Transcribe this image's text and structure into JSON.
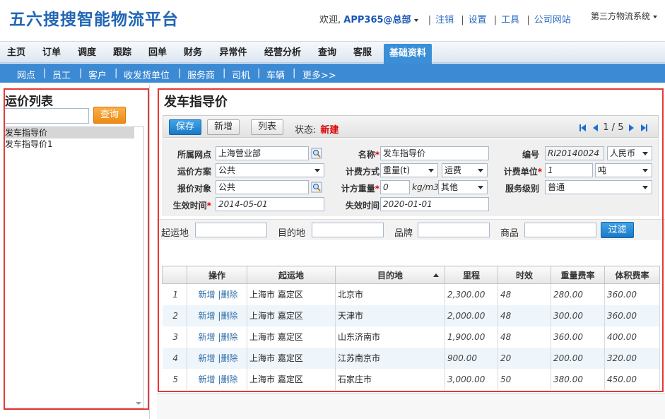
{
  "header": {
    "logo": "五六搜搜智能物流平台",
    "welcome": "欢迎,",
    "user": "APP365@总部",
    "links": [
      "注销",
      "设置",
      "工具",
      "公司网站"
    ],
    "system": "第三方物流系统"
  },
  "main_nav": [
    "主页",
    "订单",
    "调度",
    "跟踪",
    "回单",
    "财务",
    "异常件",
    "经营分析",
    "查询",
    "客服",
    "基础资料"
  ],
  "main_nav_active": "基础资料",
  "sub_nav": [
    "网点",
    "员工",
    "客户",
    "收发货单位",
    "服务商",
    "司机",
    "车辆",
    "更多>>"
  ],
  "left_panel": {
    "title": "运价列表",
    "search_value": "",
    "search_button": "查询",
    "items": [
      "发车指导价",
      "发车指导价1"
    ]
  },
  "right_panel": {
    "title": "发车指导价",
    "toolbar": {
      "save": "保存",
      "new": "新增",
      "list": "列表",
      "status_label": "状态:",
      "status_value": "新建",
      "pager": "1 / 5"
    },
    "form": {
      "branch_label": "所属网点",
      "branch": "上海营业部",
      "name_label": "名称",
      "name": "发车指导价",
      "code_label": "编号",
      "code": "RI20140024",
      "currency": "人民币",
      "scheme_label": "运价方案",
      "scheme": "公共",
      "billing_label": "计费方式",
      "billing_mode": "重量(t)",
      "billing_item": "运费",
      "billing_unit_label": "计费单位",
      "billing_unit_value": "1",
      "billing_unit": "吨",
      "quote_target_label": "报价对象",
      "quote_target": "公共",
      "weight_label": "计方重量",
      "weight_value": "0",
      "weight_unit": "kg/m3",
      "weight_other": "其他",
      "service_label": "服务级别",
      "service_level": "普通",
      "effective_label": "生效时间",
      "effective_date": "2014-05-01",
      "expire_label": "失效时间",
      "expire_date": "2020-01-01"
    },
    "filter": {
      "origin_label": "起运地",
      "dest_label": "目的地",
      "brand_label": "品牌",
      "product_label": "商品",
      "button": "过滤"
    },
    "table": {
      "headers": [
        "操作",
        "起运地",
        "目的地",
        "里程",
        "时效",
        "重量费率",
        "体积费率"
      ],
      "op_new": "新增",
      "op_sep": "|",
      "op_delete": "删除",
      "rows": [
        {
          "idx": "1",
          "origin": "上海市 嘉定区",
          "dest": "北京市",
          "distance": "2,300.00",
          "time": "48",
          "weight_rate": "280.00",
          "volume_rate": "360.00"
        },
        {
          "idx": "2",
          "origin": "上海市 嘉定区",
          "dest": "天津市",
          "distance": "2,000.00",
          "time": "48",
          "weight_rate": "300.00",
          "volume_rate": "360.00"
        },
        {
          "idx": "3",
          "origin": "上海市 嘉定区",
          "dest": "山东济南市",
          "distance": "1,900.00",
          "time": "48",
          "weight_rate": "360.00",
          "volume_rate": "400.00"
        },
        {
          "idx": "4",
          "origin": "上海市 嘉定区",
          "dest": "江苏南京市",
          "distance": "900.00",
          "time": "20",
          "weight_rate": "200.00",
          "volume_rate": "320.00"
        },
        {
          "idx": "5",
          "origin": "上海市 嘉定区",
          "dest": "石家庄市",
          "distance": "3,000.00",
          "time": "50",
          "weight_rate": "380.00",
          "volume_rate": "450.00"
        }
      ]
    }
  },
  "colors": {
    "brand": "#2166b5",
    "nav_active": "#3a8fd6",
    "subnav": "#3d8ad4",
    "query_button": "#f39c12",
    "highlight_box": "#e53935"
  }
}
